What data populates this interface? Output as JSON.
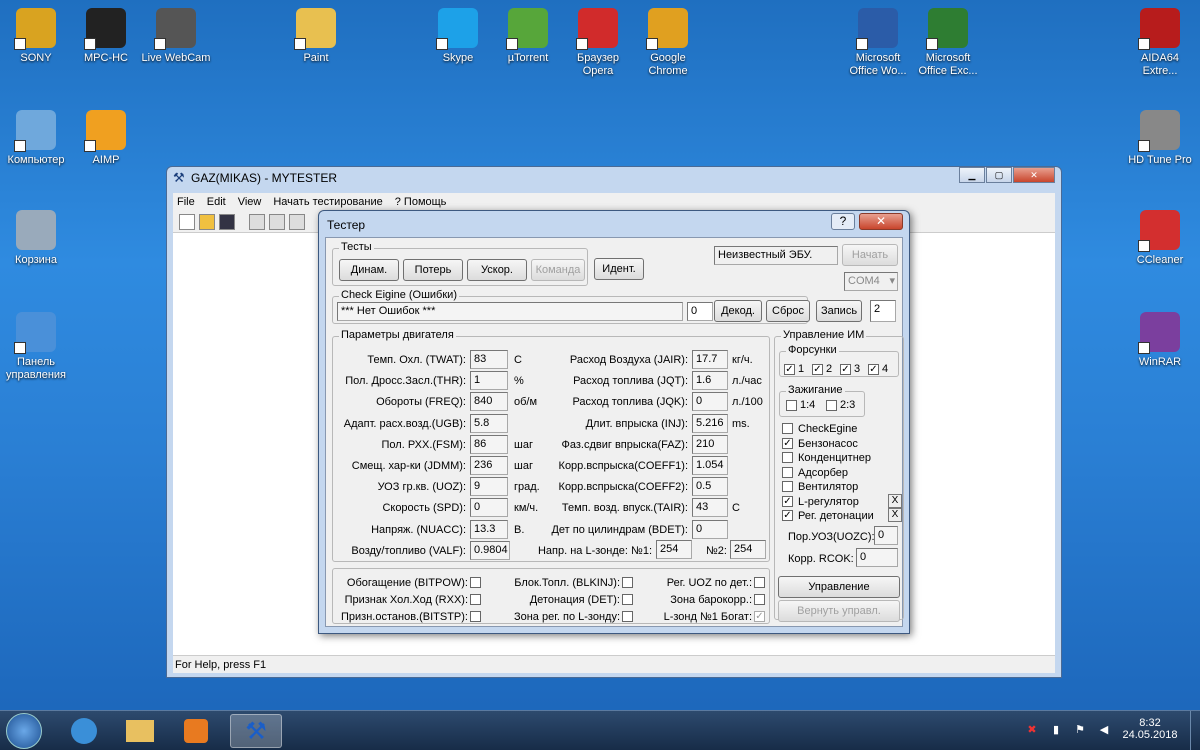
{
  "desktop_icons": [
    {
      "label": "SONY",
      "color": "#d9a320"
    },
    {
      "label": "MPC-HC",
      "color": "#222222"
    },
    {
      "label": "Live WebCam",
      "color": "#555555"
    },
    {
      "label": "Paint",
      "color": "#e8c050"
    },
    {
      "label": "Skype",
      "color": "#1da1e8"
    },
    {
      "label": "µTorrent",
      "color": "#57a63a"
    },
    {
      "label": "Браузер Opera",
      "color": "#d12b2b"
    },
    {
      "label": "Google Chrome",
      "color": "#e0a020"
    },
    {
      "label": "Microsoft Office Wo...",
      "color": "#2b5ca8"
    },
    {
      "label": "Microsoft Office Exc...",
      "color": "#2e7d32"
    },
    {
      "label": "AIDA64 Extre...",
      "color": "#b71c1c"
    },
    {
      "label": "Компьютер",
      "color": "#6fa8dc"
    },
    {
      "label": "AIMP",
      "color": "#f0a020"
    },
    {
      "label": "HD Tune Pro",
      "color": "#888888"
    },
    {
      "label": "Корзина",
      "color": "#9ab"
    },
    {
      "label": "CCleaner",
      "color": "#d32f2f"
    },
    {
      "label": "Панель управления",
      "color": "#4a90d9"
    },
    {
      "label": "WinRAR",
      "color": "#7b3f9e"
    }
  ],
  "main_window": {
    "title": "GAZ(MIKAS) - MYTESTER",
    "menu": [
      "File",
      "Edit",
      "View",
      "Начать тестирование",
      "? Помощь"
    ],
    "status": "For Help, press F1"
  },
  "dialog": {
    "title": "Тестер",
    "help_btn": "?",
    "close_btn": "✕",
    "tests": {
      "label": "Тесты",
      "dinam": "Динам.",
      "poter": "Потерь",
      "uskor": "Ускор.",
      "komanda": "Команда"
    },
    "ident": "Идент.",
    "ecu": "Неизвестный ЭБУ.",
    "start": "Начать",
    "com": "COM4",
    "check": {
      "label": "Check Eigine (Ошибки)",
      "errors": "*** Нет Ошибок ***",
      "count": "0",
      "decode": "Декод.",
      "reset": "Сброс"
    },
    "record": "Запись",
    "spin": "2",
    "params_label": "Параметры двигателя",
    "params_left": [
      {
        "label": "Темп. Охл. (TWAT):",
        "value": "83",
        "unit": "C"
      },
      {
        "label": "Пол. Дросс.Засл.(THR):",
        "value": "1",
        "unit": "%"
      },
      {
        "label": "Обороты (FREQ):",
        "value": "840",
        "unit": "об/м"
      },
      {
        "label": "Адапт. расх.возд.(UGB):",
        "value": "5.8",
        "unit": ""
      },
      {
        "label": "Пол. РХХ.(FSM):",
        "value": "86",
        "unit": "шаг"
      },
      {
        "label": "Смещ. хар-ки (JDMM):",
        "value": "236",
        "unit": "шаг"
      },
      {
        "label": "УОЗ гр.кв. (UOZ):",
        "value": "9",
        "unit": "град."
      },
      {
        "label": "Скорость (SPD):",
        "value": "0",
        "unit": "км/ч."
      },
      {
        "label": "Напряж. (NUACC):",
        "value": "13.3",
        "unit": "В."
      },
      {
        "label": "Возду/топливо (VALF):",
        "value": "0.9804",
        "unit": ""
      }
    ],
    "params_right": [
      {
        "label": "Расход Воздуха (JAIR):",
        "value": "17.7",
        "unit": "кг/ч."
      },
      {
        "label": "Расход топлива (JQT):",
        "value": "1.6",
        "unit": "л./час"
      },
      {
        "label": "Расход топлива (JQK):",
        "value": "0",
        "unit": "л./100"
      },
      {
        "label": "Длит. впрыска (INJ):",
        "value": "5.216",
        "unit": "ms."
      },
      {
        "label": "Фаз.сдвиг впрыска(FAZ):",
        "value": "210",
        "unit": ""
      },
      {
        "label": "Корр.вспрыска(COEFF1):",
        "value": "1.054",
        "unit": ""
      },
      {
        "label": "Корр.вспрыска(COEFF2):",
        "value": "0.5",
        "unit": ""
      },
      {
        "label": "Темп. возд. впуск.(TAIR):",
        "value": "43",
        "unit": "C"
      },
      {
        "label": "Дет по цилиндрам (BDET):",
        "value": "0",
        "unit": ""
      }
    ],
    "lambda": {
      "label": "Напр. на L-зонде: №1:",
      "v1": "254",
      "label2": "№2:",
      "v2": "254"
    },
    "flags": [
      {
        "label": "Обогащение (BITPOW):"
      },
      {
        "label": "Блок.Топл. (BLKINJ):"
      },
      {
        "label": "Рег. UOZ по дет.:"
      },
      {
        "label": "Признак Хол.Ход (RXX):"
      },
      {
        "label": "Детонация (DET):"
      },
      {
        "label": "Зона барокорр.:"
      },
      {
        "label": "Призн.останов.(BITSTP):"
      },
      {
        "label": "Зона рег. по L-зонду:"
      },
      {
        "label": "L-зонд №1 Богат:"
      }
    ],
    "im": {
      "label": "Управление ИМ",
      "inj_label": "Форсунки",
      "inj": [
        "1",
        "2",
        "3",
        "4"
      ],
      "ign_label": "Зажигание",
      "ign": [
        "1:4",
        "2:3"
      ],
      "checks": [
        {
          "label": "CheckEgine",
          "checked": false
        },
        {
          "label": "Бензонасос",
          "checked": true
        },
        {
          "label": "Конденцитнер",
          "checked": false
        },
        {
          "label": "Адсорбер",
          "checked": false
        },
        {
          "label": "Вентилятор",
          "checked": false
        },
        {
          "label": "L-регулятор",
          "checked": true
        },
        {
          "label": "Рег. детонации",
          "checked": true
        }
      ],
      "x": "X",
      "uozc_label": "Пор.УОЗ(UOZC):",
      "uozc": "0",
      "rcok_label": "Корр. RCOK:",
      "rcok": "0",
      "control": "Управление",
      "return": "Вернуть управл."
    }
  },
  "tray": {
    "time": "8:32",
    "date": "24.05.2018"
  }
}
